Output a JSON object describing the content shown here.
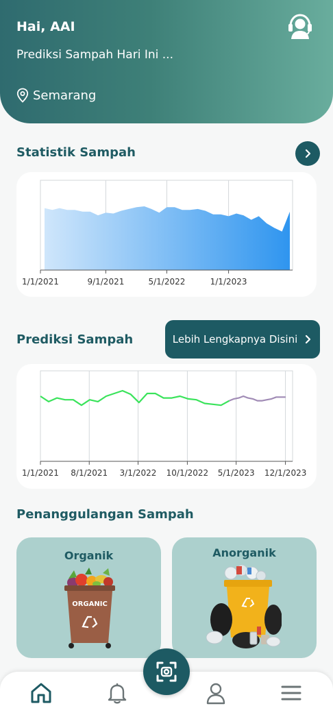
{
  "header": {
    "greeting": "Hai, AAI",
    "subtitle": "Prediksi Sampah Hari Ini ...",
    "location": "Semarang",
    "support_icon": "customer-support-icon"
  },
  "sections": {
    "statistik_title": "Statistik Sampah",
    "prediksi_title": "Prediksi Sampah",
    "more_button": "Lebih Lengkapnya Disini",
    "penanggulangan_title": "Penanggulangan Sampah"
  },
  "categories": [
    {
      "label": "Organik",
      "bin_text": "ORGANIC",
      "icon": "organic-bin-icon"
    },
    {
      "label": "Anorganik",
      "bin_text": "",
      "icon": "inorganic-bin-icon"
    }
  ],
  "nav": {
    "items": [
      "home-icon",
      "bell-icon",
      "scan-icon",
      "user-icon",
      "menu-icon"
    ]
  },
  "chart_data": [
    {
      "type": "area",
      "x_ticks": [
        "1/1/2021",
        "9/1/2021",
        "5/1/2022",
        "1/1/2023"
      ],
      "x": [
        "1/1/2021",
        "2/1/2021",
        "3/1/2021",
        "4/1/2021",
        "5/1/2021",
        "6/1/2021",
        "7/1/2021",
        "8/1/2021",
        "9/1/2021",
        "10/1/2021",
        "11/1/2021",
        "12/1/2021",
        "1/1/2022",
        "2/1/2022",
        "3/1/2022",
        "4/1/2022",
        "5/1/2022",
        "6/1/2022",
        "7/1/2022",
        "8/1/2022",
        "9/1/2022",
        "10/1/2022",
        "11/1/2022",
        "12/1/2022",
        "1/1/2023",
        "2/1/2023",
        "3/1/2023",
        "4/1/2023",
        "5/1/2023",
        "6/1/2023",
        "7/1/2023",
        "8/1/2023",
        "9/1/2023"
      ],
      "values": [
        69,
        67,
        69,
        67,
        67,
        65,
        65,
        61,
        64,
        63,
        66,
        68,
        70,
        71,
        68,
        64,
        70,
        70,
        67,
        67,
        68,
        66,
        62,
        62,
        60,
        63,
        61,
        56,
        60,
        52,
        47,
        43,
        65
      ],
      "ylim": [
        0,
        100
      ],
      "grid": true,
      "color": "#2f95ef"
    },
    {
      "type": "line",
      "x_ticks": [
        "1/1/2021",
        "8/1/2021",
        "3/1/2022",
        "10/1/2022",
        "5/1/2023",
        "12/1/2023"
      ],
      "series": [
        {
          "values": [
            72,
            66,
            70,
            68,
            68,
            62,
            68,
            66,
            72,
            75,
            78,
            74,
            65,
            75,
            75,
            70,
            70,
            72,
            69,
            68,
            64,
            63,
            62,
            67
          ],
          "color": "#3ae35b"
        },
        {
          "values": [
            67,
            69,
            70,
            72,
            70,
            69,
            67,
            67,
            68,
            69,
            71,
            71,
            71
          ],
          "color": "#a08bb5"
        }
      ],
      "x_start": "1/1/2021",
      "x_split": "4/1/2023",
      "x_end": "1/1/2024",
      "ylim": [
        0,
        100
      ],
      "grid": true
    }
  ]
}
